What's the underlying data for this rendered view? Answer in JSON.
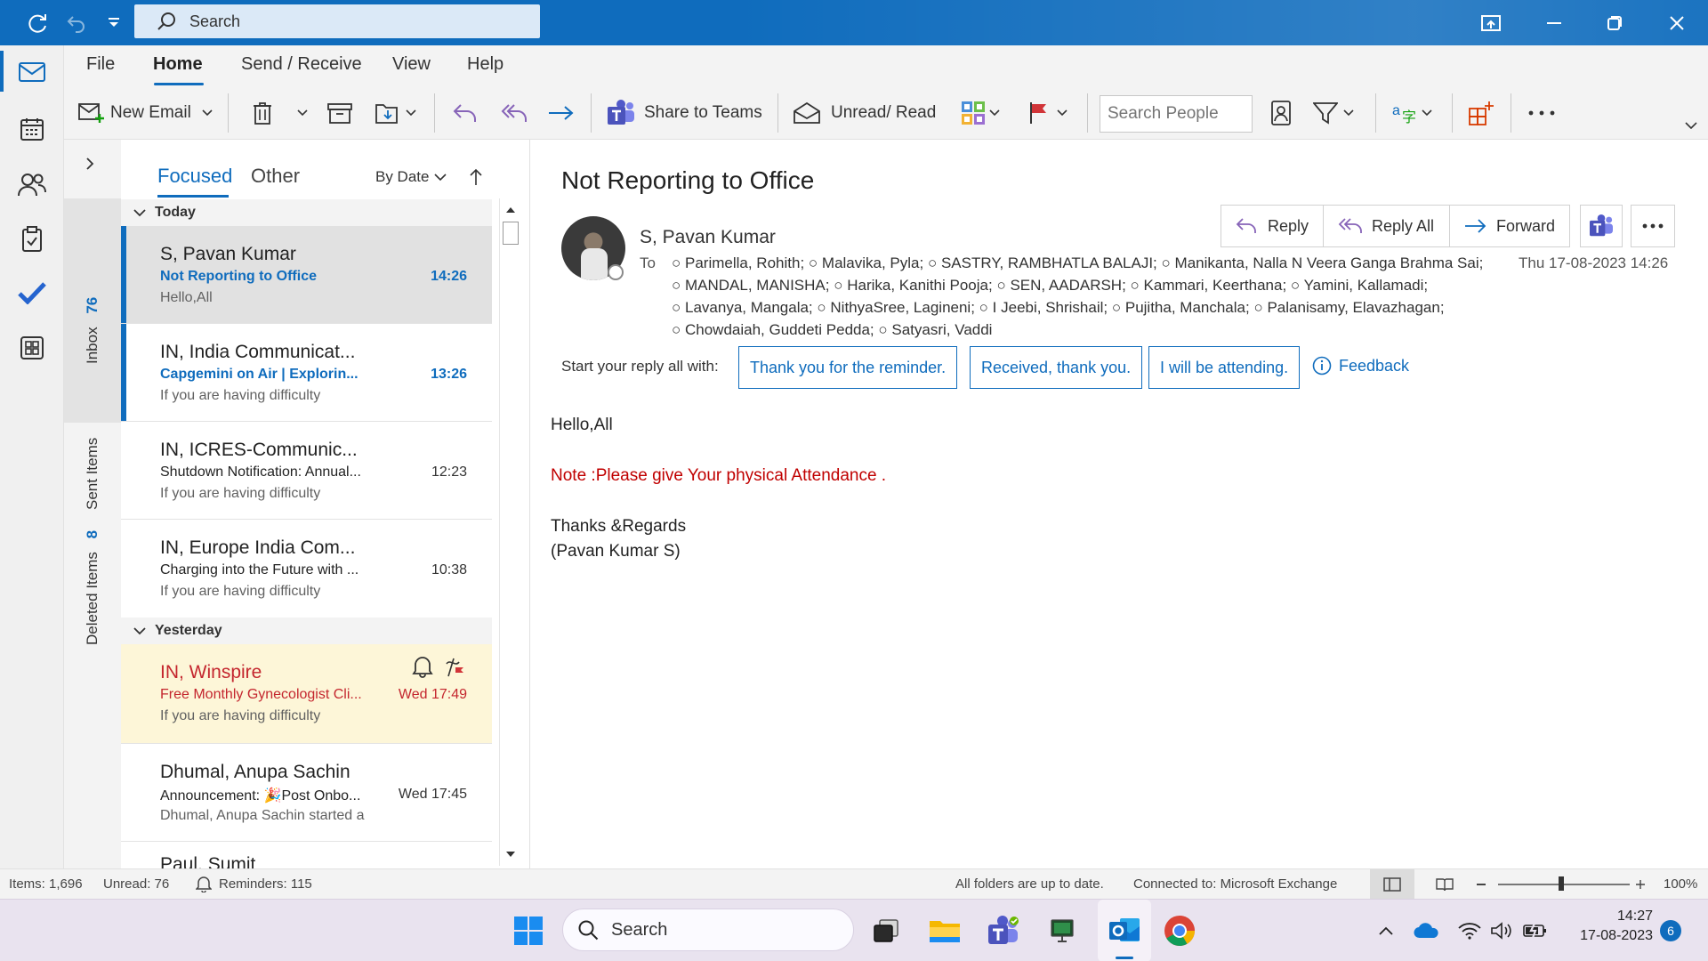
{
  "titlebar": {
    "search_placeholder": "Search",
    "icons": [
      "sync-icon",
      "undo-icon",
      "customize-quick-access-icon",
      "coming-soon-icon",
      "minimize-icon",
      "restore-icon",
      "close-icon"
    ]
  },
  "menu": {
    "items": [
      "File",
      "Home",
      "Send / Receive",
      "View",
      "Help"
    ],
    "active": "Home"
  },
  "ribbon": {
    "new_email": "New Email",
    "share_teams": "Share to Teams",
    "unread_read": "Unread/ Read",
    "search_people_placeholder": "Search People"
  },
  "rail": {
    "items": [
      "mail-icon",
      "calendar-icon",
      "people-icon",
      "tasks-icon",
      "todo-icon",
      "apps-icon"
    ]
  },
  "folders": {
    "inbox": "Inbox",
    "inbox_count": "76",
    "sent": "Sent Items",
    "deleted": "Deleted Items",
    "deleted_count": "8"
  },
  "list": {
    "tab_focused": "Focused",
    "tab_other": "Other",
    "sort": "By Date",
    "groups": [
      "Today",
      "Yesterday"
    ],
    "items": [
      {
        "from": "S, Pavan Kumar",
        "subject": "Not Reporting to Office",
        "time": "14:26",
        "preview": "Hello,All"
      },
      {
        "from": "IN, India Communicat...",
        "subject": "Capgemini on Air | Explorin...",
        "time": "13:26",
        "preview": "If you are having difficulty"
      },
      {
        "from": "IN, ICRES-Communic...",
        "subject": "Shutdown Notification: Annual...",
        "time": "12:23",
        "preview": "If you are having difficulty"
      },
      {
        "from": "IN, Europe India Com...",
        "subject": "Charging into the Future with ...",
        "time": "10:38",
        "preview": "If you are having difficulty"
      },
      {
        "from": "IN, Winspire",
        "subject": "Free Monthly Gynecologist Cli...",
        "time": "Wed 17:49",
        "preview": "If you are having difficulty"
      },
      {
        "from": "Dhumal, Anupa Sachin",
        "subject": "Announcement: 🎉Post Onbo...",
        "time": "Wed 17:45",
        "preview": "Dhumal, Anupa Sachin started a"
      },
      {
        "from": "Paul, Sumit",
        "subject": "",
        "time": "",
        "preview": ""
      }
    ]
  },
  "reading": {
    "subject": "Not Reporting to Office",
    "sender": "S, Pavan Kumar",
    "to_label": "To",
    "datetime": "Thu 17-08-2023 14:26",
    "recipients_line1": [
      "Parimella, Rohith;",
      "Malavika, Pyla;",
      "SASTRY, RAMBHATLA BALAJI;",
      "Manikanta, Nalla N Veera Ganga Brahma Sai;"
    ],
    "recipients_line2": [
      "MANDAL, MANISHA;",
      "Harika, Kanithi Pooja;",
      "SEN, AADARSH;",
      "Kammari, Keerthana;",
      "Yamini, Kallamadi;"
    ],
    "recipients_line3": [
      "Lavanya, Mangala;",
      "NithyaSree, Lagineni;",
      "I Jeebi, Shrishail;",
      "Pujitha, Manchala;",
      "Palanisamy, Elavazhagan;"
    ],
    "recipients_line4": [
      "Chowdaiah, Guddeti Pedda;",
      "Satyasri, Vaddi"
    ],
    "reply": "Reply",
    "reply_all": "Reply All",
    "forward": "Forward",
    "suggest_label": "Start your reply all with:",
    "suggestions": [
      "Thank you for the reminder.",
      "Received, thank you.",
      "I will be attending."
    ],
    "feedback": "Feedback",
    "body_greeting": "Hello,All",
    "body_note": "Note :Please give Your physical Attendance .",
    "body_thanks": "Thanks &Regards",
    "body_sign": "(Pavan Kumar S)",
    "note_color": "#c00000"
  },
  "status": {
    "items": "Items: 1,696",
    "unread": "Unread: 76",
    "reminders": "Reminders: 115",
    "folders_uptodate": "All folders are up to date.",
    "connected": "Connected to: Microsoft Exchange",
    "zoom": "100%"
  },
  "taskbar": {
    "search": "Search",
    "time": "14:27",
    "date": "17-08-2023",
    "notif_count": "6"
  },
  "colors": {
    "accent": "#0f6cbd",
    "winspire_bg": "#fdf6d8",
    "winspire_text": "#c4262e"
  }
}
